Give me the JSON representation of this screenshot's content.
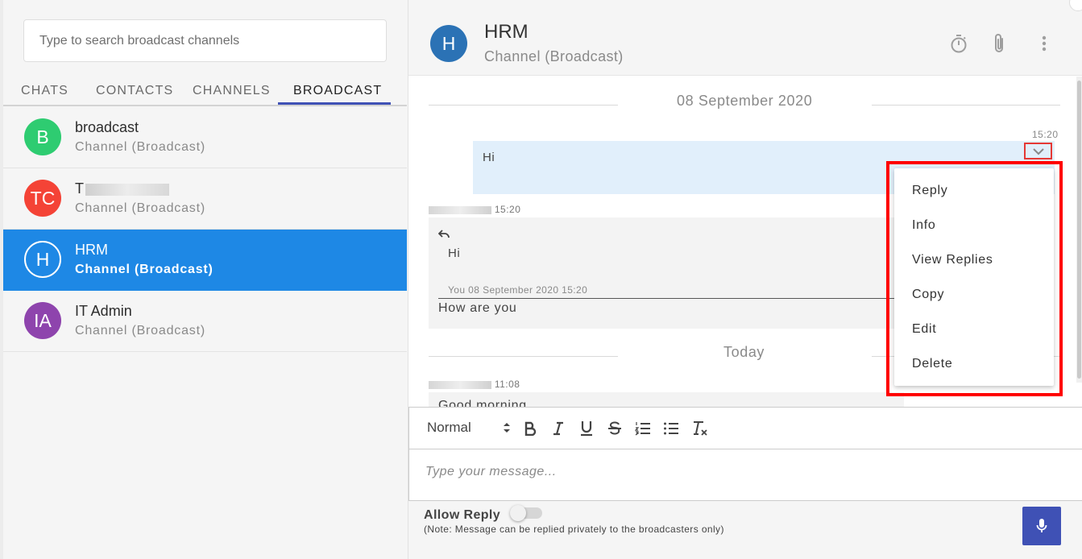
{
  "search": {
    "placeholder": "Type to search broadcast channels"
  },
  "tabs": [
    {
      "label": "CHATS",
      "active": false
    },
    {
      "label": "CONTACTS",
      "active": false
    },
    {
      "label": "CHANNELS",
      "active": false
    },
    {
      "label": "BROADCAST",
      "active": true
    }
  ],
  "channels": [
    {
      "initials": "B",
      "name": "broadcast",
      "sub": "Channel (Broadcast)",
      "color": "#2ecc71",
      "selected": false
    },
    {
      "initials": "TC",
      "name": "T",
      "sub": "Channel (Broadcast)",
      "color": "#f44336",
      "selected": false,
      "name_redacted": true
    },
    {
      "initials": "H",
      "name": "HRM",
      "sub": "Channel (Broadcast)",
      "color": "#2b72b5",
      "selected": true
    },
    {
      "initials": "IA",
      "name": "IT Admin",
      "sub": "Channel (Broadcast)",
      "color": "#8e44ad",
      "selected": false
    }
  ],
  "header": {
    "initials": "H",
    "title": "HRM",
    "subtitle": "Channel (Broadcast)",
    "icons": [
      "timer-icon",
      "paperclip-icon",
      "more-vert-icon"
    ]
  },
  "messages": {
    "date1": "08 September 2020",
    "out_time": "15:20",
    "out_text": "Hi",
    "in_sender_time": "15:20",
    "quote_text": "Hi",
    "quote_meta": "You 08 September 2020 15:20",
    "reply_text": "How are you",
    "date2": "Today",
    "in2_sender_time": "11:08",
    "in2_text": "Good morning"
  },
  "context_menu": {
    "items": [
      "Reply",
      "Info",
      "View Replies",
      "Copy",
      "Edit",
      "Delete"
    ]
  },
  "editor": {
    "format": "Normal",
    "placeholder": "Type your message..."
  },
  "footer": {
    "allow_reply": "Allow Reply",
    "allow_reply_on": false,
    "note": "(Note: Message can be replied privately to the broadcasters only)"
  },
  "colors": {
    "accent": "#3f51b5",
    "selected": "#1e88e5",
    "highlight_frame": "#ff0000",
    "outgoing_bubble": "#e1effb"
  }
}
